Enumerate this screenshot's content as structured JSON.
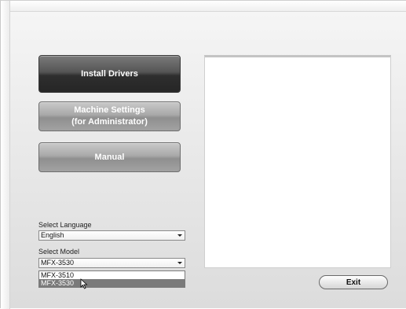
{
  "menu": {
    "install_drivers": "Install Drivers",
    "machine_settings_line1": "Machine Settings",
    "machine_settings_line2": "(for Administrator)",
    "manual": "Manual"
  },
  "language": {
    "label": "Select Language",
    "selected": "English"
  },
  "model": {
    "label": "Select Model",
    "selected": "MFX-3530",
    "options": [
      "MFX-3510",
      "MFX-3530"
    ],
    "highlighted_option": "MFX-3530"
  },
  "footer": {
    "exit_label": "Exit"
  },
  "colors": {
    "primary_button": "#2e2e2e",
    "secondary_button": "#a8a8a8",
    "highlight": "#7a7a7a"
  },
  "icons": {
    "pointer": "mouse-cursor-icon",
    "dropdown": "chevron-down-icon"
  }
}
